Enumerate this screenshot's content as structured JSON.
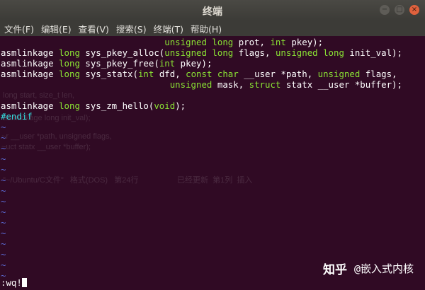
{
  "window": {
    "title": "终端",
    "minimize_icon": "−",
    "maximize_icon": "□",
    "close_icon": "×"
  },
  "menu": [
    "文件(F)",
    "编辑(E)",
    "查看(V)",
    "搜索(S)",
    "终端(T)",
    "帮助(H)"
  ],
  "code": {
    "l0_a": "                               ",
    "l0_kw": "unsigned long",
    "l0_b": " prot, ",
    "l0_kw2": "int",
    "l0_c": " pkey);",
    "l1_a": "asmlinkage ",
    "l1_kw": "long",
    "l1_b": " sys_pkey_alloc(",
    "l1_kw2": "unsigned long",
    "l1_c": " flags, ",
    "l1_kw3": "unsigned long",
    "l1_d": " init_val);",
    "l2_a": "asmlinkage ",
    "l2_kw": "long",
    "l2_b": " sys_pkey_free(",
    "l2_kw2": "int",
    "l2_c": " pkey);",
    "l3_a": "asmlinkage ",
    "l3_kw": "long",
    "l3_b": " sys_statx(",
    "l3_kw2": "int",
    "l3_c": " dfd, ",
    "l3_kw3": "const char",
    "l3_d": " __user *path, ",
    "l3_kw4": "unsigned",
    "l3_e": " flags,",
    "l4_a": "                                ",
    "l4_kw": "unsigned",
    "l4_b": " mask, ",
    "l4_kw2": "struct",
    "l4_c": " statx __user *buffer);",
    "l6_a": "asmlinkage ",
    "l6_kw": "long",
    "l6_b": " sys_zm_hello(",
    "l6_kw2": "void",
    "l6_c": ");",
    "l7": "#endif"
  },
  "tilde": "~",
  "command": ":wq!",
  "watermark": {
    "site": "知乎",
    "author": "@嵌入式内核"
  },
  "ghost": {
    "g1": "long start, size_t len,",
    "g2": "asmlinkage long init_val);",
    "g3": "~r __user *path, unsigned flags,",
    "g4": "~uct statx __user *buffer);",
    "g5": "\"~/Ubuntu/C文件\"   格式(DOS)   第24行",
    "g6": "已经更新  第1列  插入"
  },
  "colors": {
    "background": "#300a24",
    "keyword": "#8ae234",
    "preprocessor": "#34e2e2",
    "tilde": "#5c6bd6"
  }
}
